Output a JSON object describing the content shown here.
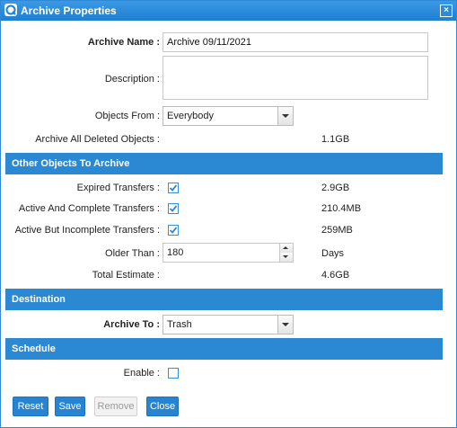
{
  "window": {
    "title": "Archive Properties"
  },
  "form": {
    "archive_name": {
      "label": "Archive Name :",
      "value": "Archive 09/11/2021"
    },
    "description": {
      "label": "Description :",
      "value": ""
    },
    "objects_from": {
      "label": "Objects From :",
      "value": "Everybody"
    },
    "archive_deleted": {
      "label": "Archive All Deleted Objects :",
      "value": "1.1GB"
    }
  },
  "sections": {
    "other_objects": "Other Objects To Archive",
    "destination": "Destination",
    "schedule": "Schedule"
  },
  "other_objects": {
    "expired": {
      "label": "Expired Transfers :",
      "checked": true,
      "value": "2.9GB"
    },
    "active_complete": {
      "label": "Active And Complete Transfers :",
      "checked": true,
      "value": "210.4MB"
    },
    "active_incomplete": {
      "label": "Active But Incomplete Transfers :",
      "checked": true,
      "value": "259MB"
    },
    "older_than": {
      "label": "Older Than :",
      "value": "180",
      "unit": "Days"
    },
    "total_estimate": {
      "label": "Total Estimate :",
      "value": "4.6GB"
    }
  },
  "destination": {
    "archive_to": {
      "label": "Archive To :",
      "value": "Trash"
    }
  },
  "schedule": {
    "enable": {
      "label": "Enable :",
      "checked": false
    }
  },
  "buttons": {
    "reset": "Reset",
    "save": "Save",
    "remove": "Remove",
    "close": "Close"
  },
  "colors": {
    "accent": "#2b89d4",
    "titlebar": "#1f7fd1"
  }
}
